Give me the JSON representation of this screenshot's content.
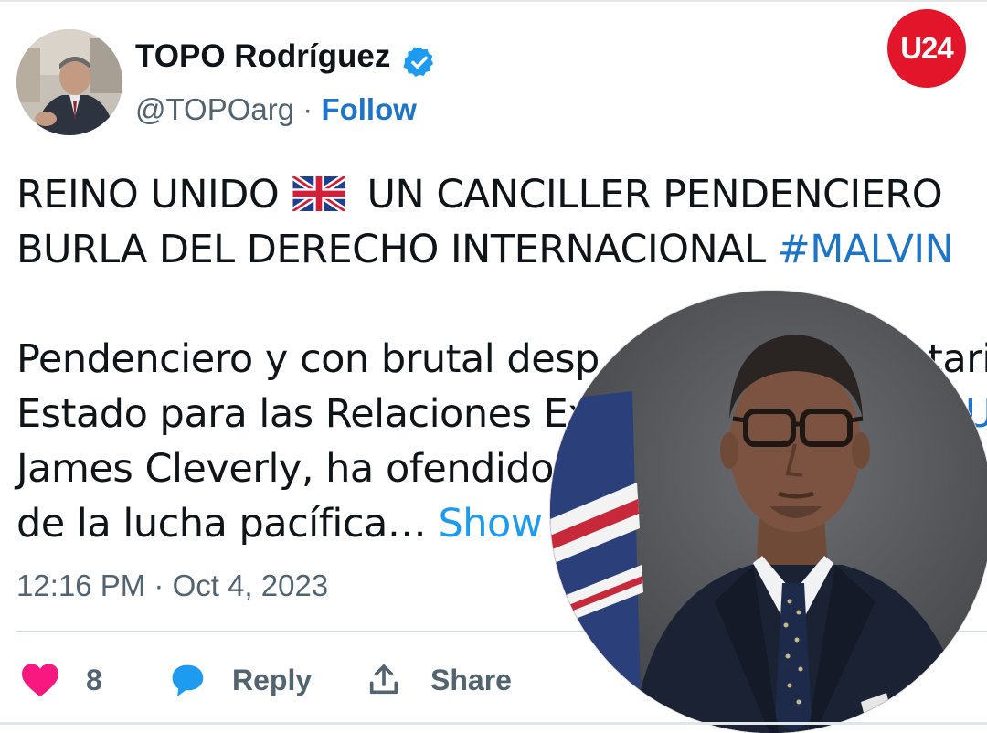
{
  "author": {
    "name": "TOPO Rodríguez",
    "handle": "@TOPOarg",
    "separator": "·",
    "follow_label": "Follow"
  },
  "brand_badge": "U24",
  "tweet": {
    "line1_before_flag": "REINO UNIDO",
    "line1_after_flag": "UN CANCILLER PENDENCIERO",
    "line2_text": "BURLA DEL DERECHO INTERNACIONAL ",
    "line2_hashtag": "#MALVIN",
    "line3": "Pendenciero y con brutal desp",
    "line3_right": "tario",
    "line4": "Estado para las Relaciones Ex",
    "line4_right": "U",
    "line5": "James Cleverly, ha ofendido",
    "line6": "de la lucha pacífica… ",
    "show_more": "Show"
  },
  "timestamp": "12:16 PM · Oct 4, 2023",
  "actions": {
    "like_count": "8",
    "reply_label": "Reply",
    "share_label": "Share"
  },
  "colors": {
    "like": "#f91880",
    "reply": "#1d9bf0",
    "link": "#1d74c9",
    "brand": "#e3152a"
  },
  "icons": {
    "verified": "verified-badge-icon",
    "flag": "uk-flag-icon",
    "like": "heart-icon",
    "reply": "speech-bubble-icon",
    "share": "share-upload-icon"
  }
}
